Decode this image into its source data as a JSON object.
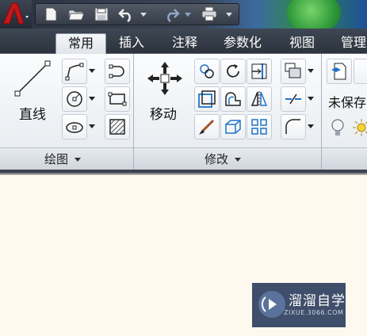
{
  "titlebar": {
    "qat_icons": [
      "new-icon",
      "open-icon",
      "save-icon",
      "undo-icon",
      "redo-icon",
      "plot-icon"
    ]
  },
  "tabs": [
    {
      "label": "常用",
      "active": true
    },
    {
      "label": "插入",
      "active": false
    },
    {
      "label": "注释",
      "active": false
    },
    {
      "label": "参数化",
      "active": false
    },
    {
      "label": "视图",
      "active": false
    },
    {
      "label": "管理",
      "active": false
    }
  ],
  "draw_panel": {
    "line_label": "直线",
    "panel_label": "绘图"
  },
  "modify_panel": {
    "move_label": "移动",
    "panel_label": "修改"
  },
  "layers_panel": {
    "state_text": "未保存"
  },
  "watermark": {
    "title": "溜溜自学",
    "subtitle": "ZIXUE.3066.COM"
  },
  "colors": {
    "accent_blue": "#1e73c8",
    "workspace": "#fdf9ee",
    "logo_red": "#c0181b"
  }
}
